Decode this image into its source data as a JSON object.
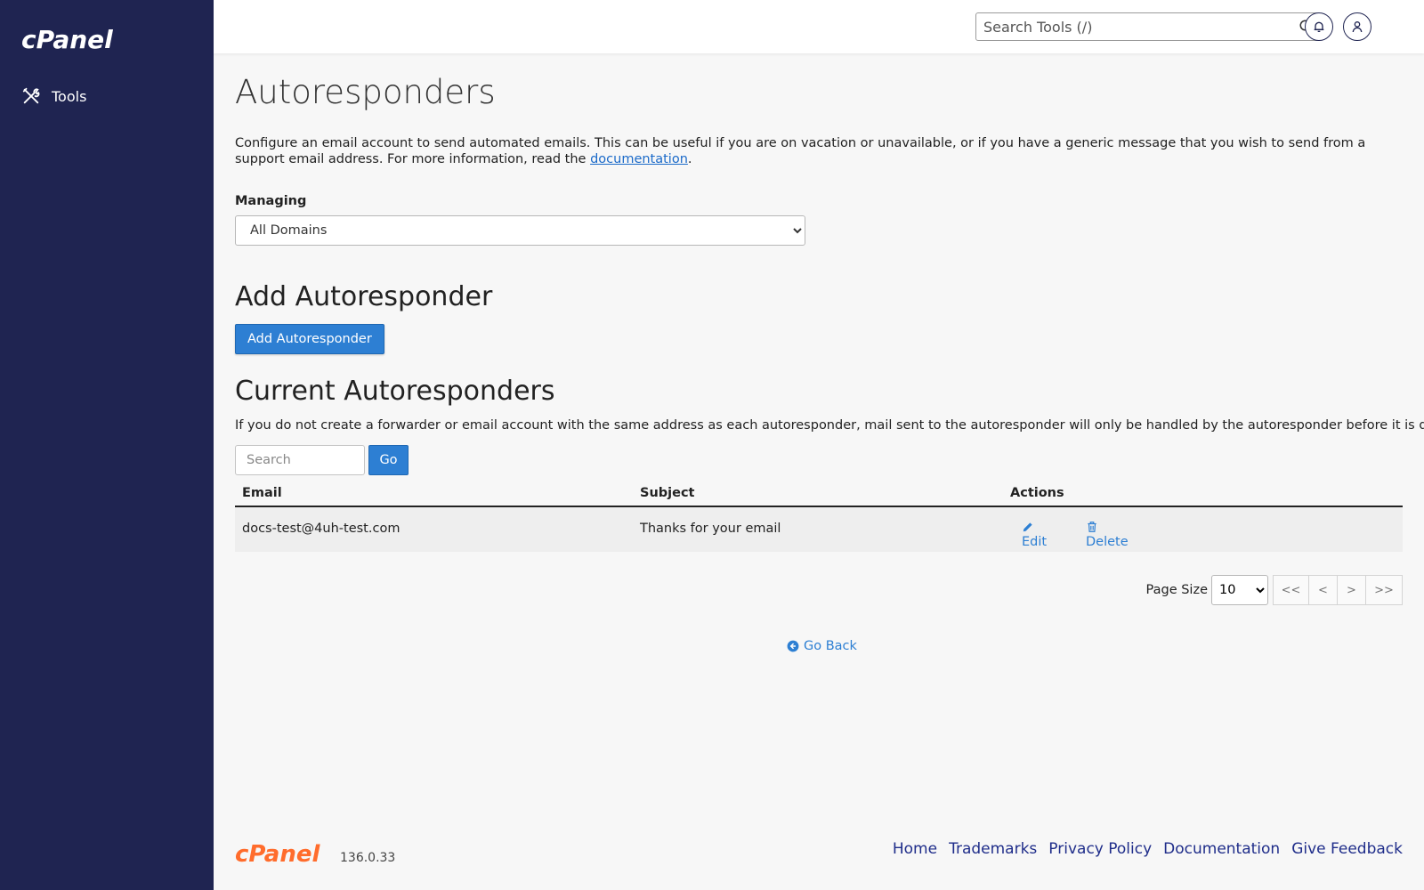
{
  "brand": {
    "name": "cPanel",
    "color": "#ffffff",
    "accent": "#ff6c2c"
  },
  "sidebar": {
    "items": [
      {
        "label": "Tools",
        "icon": "tools-icon"
      }
    ]
  },
  "header": {
    "search_placeholder": "Search Tools (/)",
    "icons": [
      "search-icon",
      "bell-icon",
      "user-icon"
    ]
  },
  "page": {
    "title": "Autoresponders",
    "intro_text": "Configure an email account to send automated emails. This can be useful if you are on vacation or unavailable, or if you have a generic message that you wish to send from a support email address. For more information, read the ",
    "intro_link": "documentation",
    "intro_end": ".",
    "managing_label": "Managing",
    "managing_value": "All Domains"
  },
  "add_section": {
    "heading": "Add Autoresponder",
    "button_label": "Add Autoresponder"
  },
  "current_section": {
    "heading": "Current Autoresponders",
    "note": "If you do not create a forwarder or email account with the same address as each autoresponder, mail sent to the autoresponder will only be handled by the autoresponder before it is discarded.",
    "search_placeholder": "Search",
    "go_label": "Go"
  },
  "table": {
    "columns": [
      "Email",
      "Subject",
      "Actions"
    ],
    "rows": [
      {
        "email": "docs-test@4uh-test.com",
        "subject": "Thanks for your email",
        "edit": "Edit",
        "delete": "Delete"
      }
    ]
  },
  "pagination": {
    "page_size_label": "Page Size",
    "page_size": "10",
    "buttons": [
      "<<",
      "<",
      ">",
      ">>"
    ]
  },
  "go_back": "Go Back",
  "footer": {
    "version": "136.0.33",
    "links": [
      "Home",
      "Trademarks",
      "Privacy Policy",
      "Documentation",
      "Give Feedback"
    ]
  },
  "colors": {
    "sidebar_bg": "#1f2451",
    "primary": "#2d7fd3",
    "link": "#1f2d8a"
  }
}
